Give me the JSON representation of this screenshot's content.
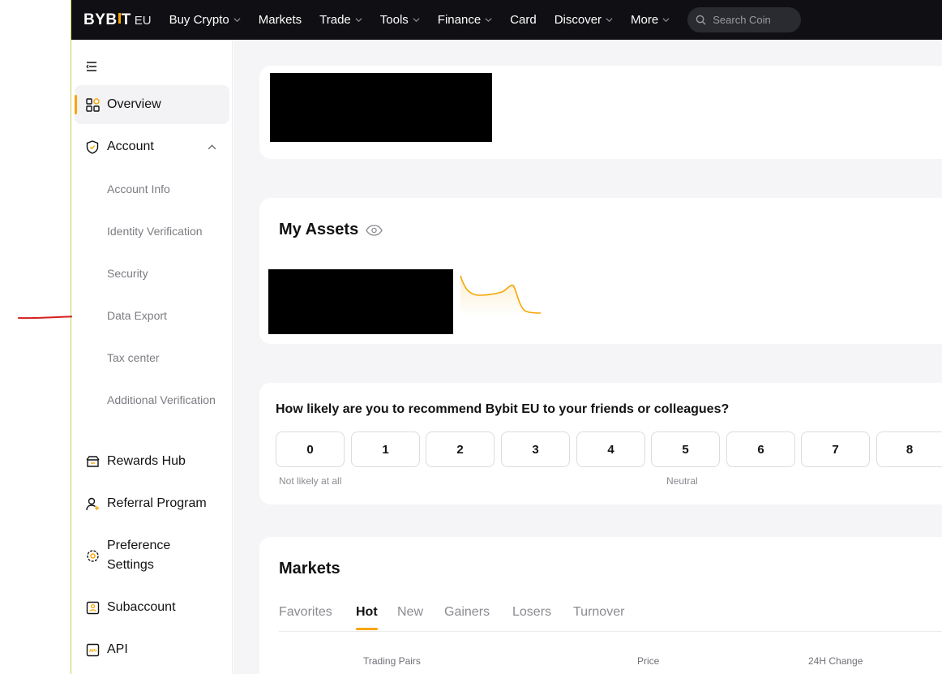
{
  "brand": {
    "logo_left": "BYB",
    "logo_right": "T",
    "logo_region": "EU",
    "accent": "#f7a600"
  },
  "topnav": {
    "items": [
      {
        "label": "Buy Crypto",
        "dropdown": true
      },
      {
        "label": "Markets",
        "dropdown": false
      },
      {
        "label": "Trade",
        "dropdown": true
      },
      {
        "label": "Tools",
        "dropdown": true
      },
      {
        "label": "Finance",
        "dropdown": true
      },
      {
        "label": "Card",
        "dropdown": false
      },
      {
        "label": "Discover",
        "dropdown": true
      },
      {
        "label": "More",
        "dropdown": true
      }
    ],
    "search_placeholder": "Search Coin"
  },
  "sidebar": {
    "overview": "Overview",
    "account": "Account",
    "account_sub": [
      "Account Info",
      "Identity Verification",
      "Security",
      "Data Export",
      "Tax center",
      "Additional Verification"
    ],
    "rewards": "Rewards Hub",
    "referral": "Referral Program",
    "preferences": "Preference Settings",
    "subaccount": "Subaccount",
    "api": "API",
    "api_badge": "API"
  },
  "assets": {
    "title": "My Assets"
  },
  "nps": {
    "question": "How likely are you to recommend Bybit EU to your friends or colleagues?",
    "scores": [
      "0",
      "1",
      "2",
      "3",
      "4",
      "5",
      "6",
      "7",
      "8"
    ],
    "label_low": "Not likely at all",
    "label_mid": "Neutral"
  },
  "markets": {
    "title": "Markets",
    "tabs": [
      "Favorites",
      "Hot",
      "New",
      "Gainers",
      "Losers",
      "Turnover"
    ],
    "active_tab": "Hot",
    "columns": [
      "Trading Pairs",
      "Price",
      "24H Change"
    ]
  }
}
